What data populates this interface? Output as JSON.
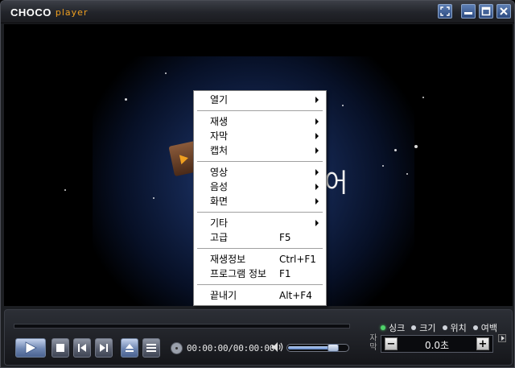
{
  "titlebar": {
    "brand_name": "CHOCO",
    "brand_sub": "player",
    "buttons": {
      "fullscreen_icon": "fullscreen-icon",
      "minimize_icon": "minimize-icon",
      "maximize_icon": "maximize-icon",
      "close_icon": "close-icon"
    }
  },
  "video": {
    "logo_char": "어"
  },
  "context_menu": {
    "items": [
      {
        "label": "열기",
        "shortcut": "",
        "submenu": true
      },
      {
        "separator": true
      },
      {
        "label": "재생",
        "shortcut": "",
        "submenu": true
      },
      {
        "label": "자막",
        "shortcut": "",
        "submenu": true
      },
      {
        "label": "캡처",
        "shortcut": "",
        "submenu": true
      },
      {
        "separator": true
      },
      {
        "label": "영상",
        "shortcut": "",
        "submenu": true
      },
      {
        "label": "음성",
        "shortcut": "",
        "submenu": true
      },
      {
        "label": "화면",
        "shortcut": "",
        "submenu": true
      },
      {
        "separator": true
      },
      {
        "label": "기타",
        "shortcut": "",
        "submenu": true
      },
      {
        "label": "고급",
        "shortcut": "F5",
        "submenu": false
      },
      {
        "separator": true
      },
      {
        "label": "재생정보",
        "shortcut": "Ctrl+F1",
        "submenu": false
      },
      {
        "label": "프로그램 정보",
        "shortcut": "F1",
        "submenu": false
      },
      {
        "separator": true
      },
      {
        "label": "끝내기",
        "shortcut": "Alt+F4",
        "submenu": false
      }
    ]
  },
  "controls": {
    "time": "00:00:00/00:00:00",
    "volume_level": 0.82,
    "buttons": [
      "play-icon",
      "stop-icon",
      "prev-icon",
      "next-icon",
      "eject-icon",
      "playlist-icon"
    ]
  },
  "subtitle_panel": {
    "tabs": [
      {
        "label": "싱크",
        "active": true
      },
      {
        "label": "크기",
        "active": false
      },
      {
        "label": "위치",
        "active": false
      },
      {
        "label": "여백",
        "active": false
      }
    ],
    "side_label": "자막",
    "value": "0.0초",
    "minus": "−",
    "plus": "+"
  },
  "colors": {
    "accent": "#f0a020",
    "button_blue": "#6e86b2",
    "active_dot": "#4fd36a"
  }
}
